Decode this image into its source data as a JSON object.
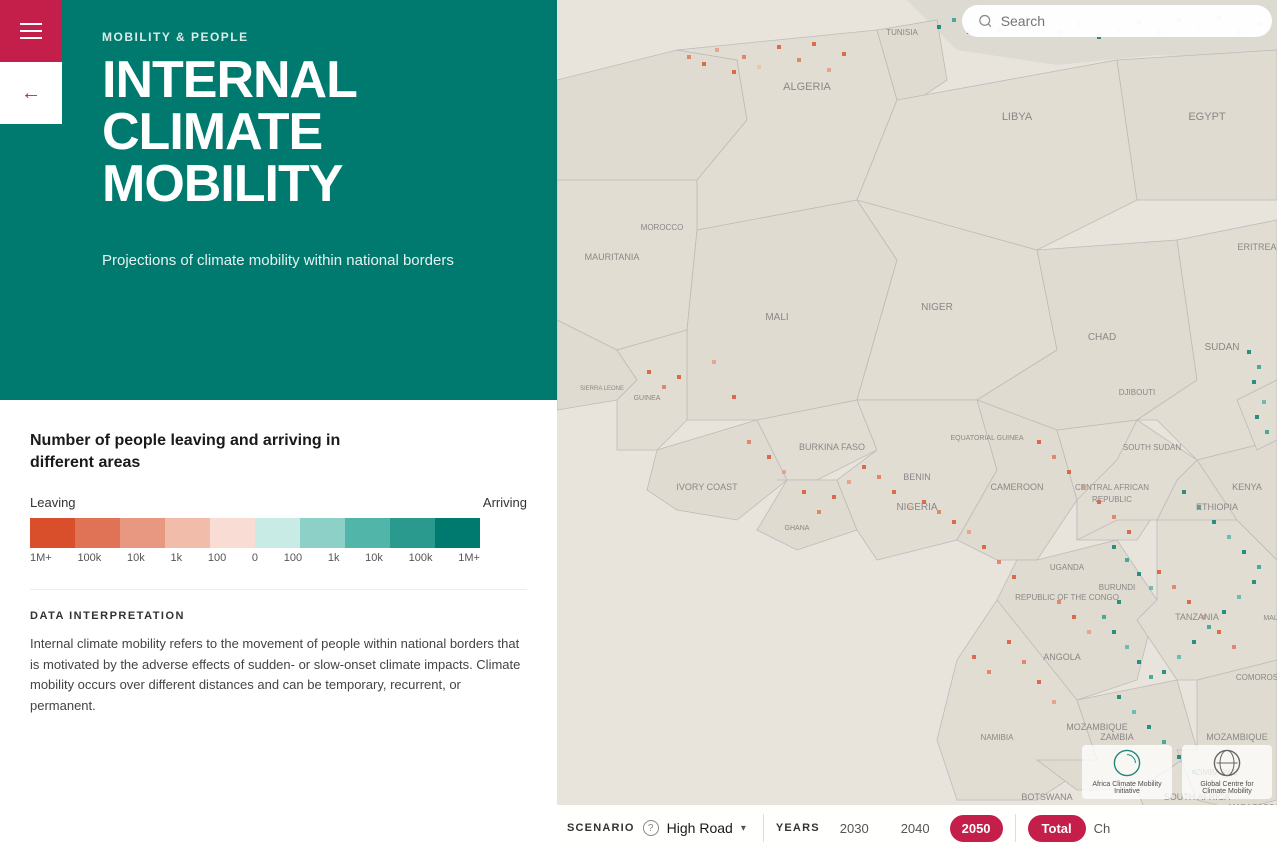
{
  "header": {
    "menu_label": "Menu",
    "back_label": "Back",
    "category": "MOBILITY & PEOPLE",
    "title_line1": "INTERNAL CLIMATE",
    "title_line2": "MOBILITY",
    "subtitle": "Projections of climate mobility within national borders"
  },
  "legend": {
    "leaving_label": "Leaving",
    "arriving_label": "Arriving",
    "colors_leaving": [
      "#d94f2b",
      "#e07356",
      "#e89880",
      "#f1bcaa",
      "#f9ddd5"
    ],
    "colors_arriving": [
      "#c8ebe6",
      "#8dd0c8",
      "#52b5aa",
      "#2a9a8e",
      "#007a6e"
    ],
    "values": [
      "1M+",
      "100k",
      "10k",
      "1k",
      "100",
      "0",
      "100",
      "1k",
      "10k",
      "100k",
      "1M+"
    ]
  },
  "data_interpretation": {
    "title": "DATA INTERPRETATION",
    "text": "Internal climate mobility refers to the movement of people within national borders that is motivated by the adverse effects of sudden- or slow-onset climate impacts. Climate mobility occurs over different distances and can be temporary, recurrent, or permanent."
  },
  "search": {
    "placeholder": "Search"
  },
  "bottom_bar": {
    "scenario_label": "SCENARIO",
    "scenario_value": "High Road",
    "years_label": "YEARS",
    "year_2030": "2030",
    "year_2040": "2040",
    "year_2050": "2050",
    "total_label": "Total",
    "ch_label": "Ch",
    "scenario_help": "?"
  },
  "logos": {
    "logo1": "Africa Climate Mobility Initiative",
    "logo2": "Global Centre for Climate Mobility"
  },
  "colors": {
    "teal": "#007a6e",
    "red_accent": "#c41e4a",
    "white": "#ffffff"
  }
}
